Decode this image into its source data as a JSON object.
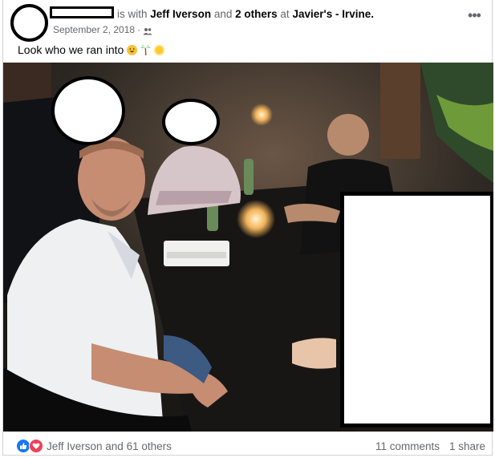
{
  "post": {
    "header_prefix": "is with",
    "tagged_person": "Jeff Iverson",
    "and_text": "and",
    "others": "2 others",
    "at_text": "at",
    "location": "Javier's - Irvine.",
    "date": "September 2, 2018",
    "separator": "·",
    "privacy_icon": "friends-icon",
    "more_label": "•••",
    "caption": "Look who we ran into",
    "caption_emojis": [
      "grinning-face-icon",
      "palm-tree-icon",
      "sun-icon"
    ]
  },
  "footer": {
    "reactions": [
      "like-icon",
      "love-icon"
    ],
    "reaction_text": "Jeff Iverson and 61 others",
    "comments": "11 comments",
    "shares": "1 share"
  },
  "colors": {
    "like": "#1877f2",
    "love": "#f33e58",
    "secondary_text": "#65676b"
  }
}
